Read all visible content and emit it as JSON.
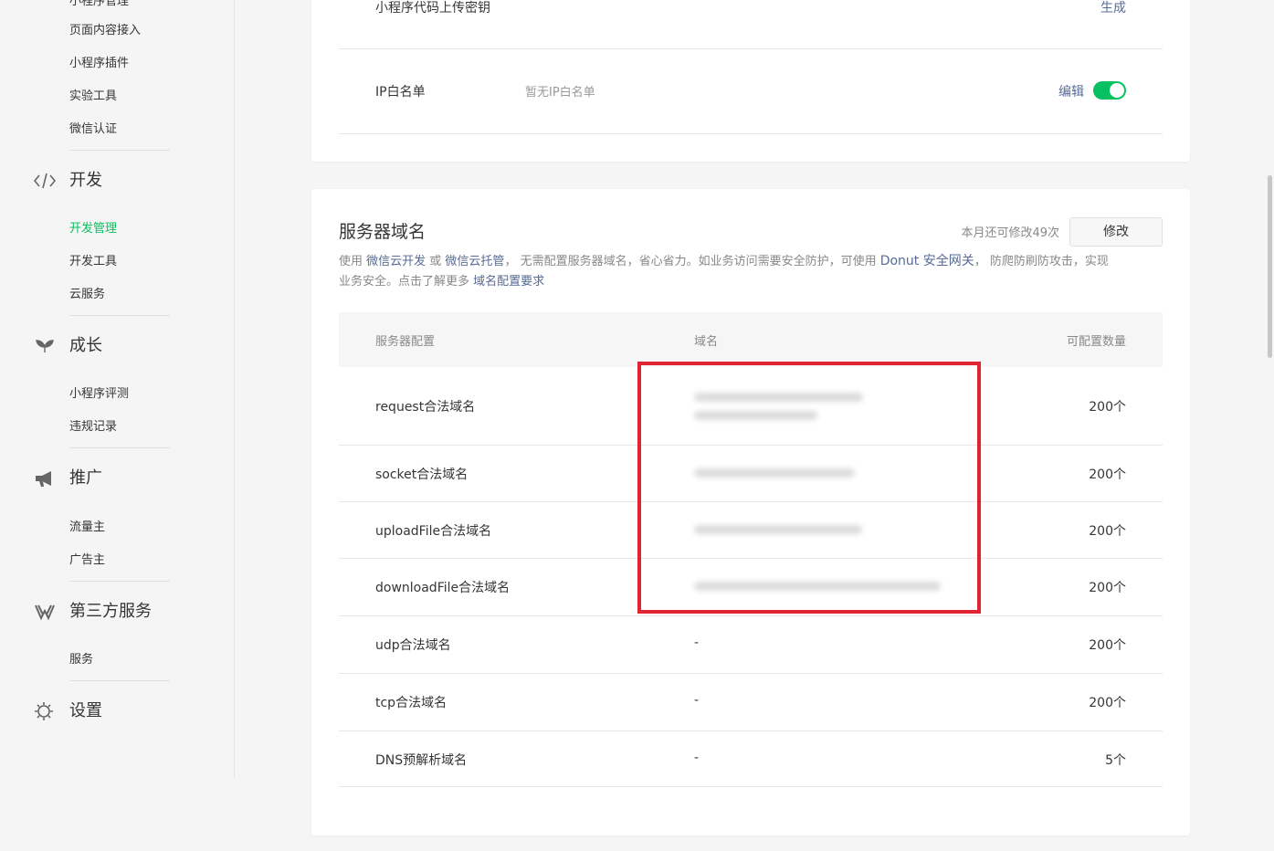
{
  "sidebar": {
    "top_cut_item": "小程序管理",
    "groups": [
      {
        "label": "开发",
        "icon": "code-icon",
        "items": [
          "开发管理",
          "开发工具",
          "云服务"
        ],
        "active": "开发管理"
      },
      {
        "label": "成长",
        "icon": "sprout-icon",
        "items": [
          "小程序评测",
          "违规记录"
        ]
      },
      {
        "label": "推广",
        "icon": "megaphone-icon",
        "items": [
          "流量主",
          "广告主"
        ]
      },
      {
        "label": "第三方服务",
        "icon": "third-party-icon",
        "items": [
          "服务"
        ]
      },
      {
        "label": "设置",
        "icon": "gear-icon",
        "items": []
      }
    ],
    "pre_items": [
      "页面内容接入",
      "小程序插件",
      "实验工具",
      "微信认证"
    ]
  },
  "top_card": {
    "upload_key_label": "小程序代码上传密钥",
    "upload_key_action": "生成",
    "ip_label": "IP白名单",
    "ip_value": "暂无IP白名单",
    "ip_edit": "编辑",
    "ip_toggle_on": true
  },
  "server_domain": {
    "title": "服务器域名",
    "quota_text": "本月还可修改49次",
    "modify_button": "修改",
    "desc": {
      "p1": "使用 ",
      "l1": "微信云开发",
      "p2": " 或 ",
      "l2": "微信云托管",
      "p3": "， 无需配置服务器域名，省心省力。如业务访问需要安全防护，可使用 ",
      "l3": "Donut 安全网关",
      "p4": "， 防爬防刷防攻击，实现",
      "p5": "业务安全。点击了解更多 ",
      "l4": "域名配置要求"
    },
    "columns": [
      "服务器配置",
      "域名",
      "可配置数量"
    ],
    "rows": [
      {
        "name": "request合法域名",
        "domain": "",
        "count": "200个"
      },
      {
        "name": "socket合法域名",
        "domain": "",
        "count": "200个"
      },
      {
        "name": "uploadFile合法域名",
        "domain": "",
        "count": "200个"
      },
      {
        "name": "downloadFile合法域名",
        "domain": "",
        "count": "200个"
      },
      {
        "name": "udp合法域名",
        "domain": "-",
        "count": "200个"
      },
      {
        "name": "tcp合法域名",
        "domain": "-",
        "count": "200个"
      },
      {
        "name": "DNS预解析域名",
        "domain": "-",
        "count": "5个"
      }
    ]
  },
  "colors": {
    "accent": "#07c160",
    "link": "#576b95",
    "highlight": "#e02434"
  }
}
